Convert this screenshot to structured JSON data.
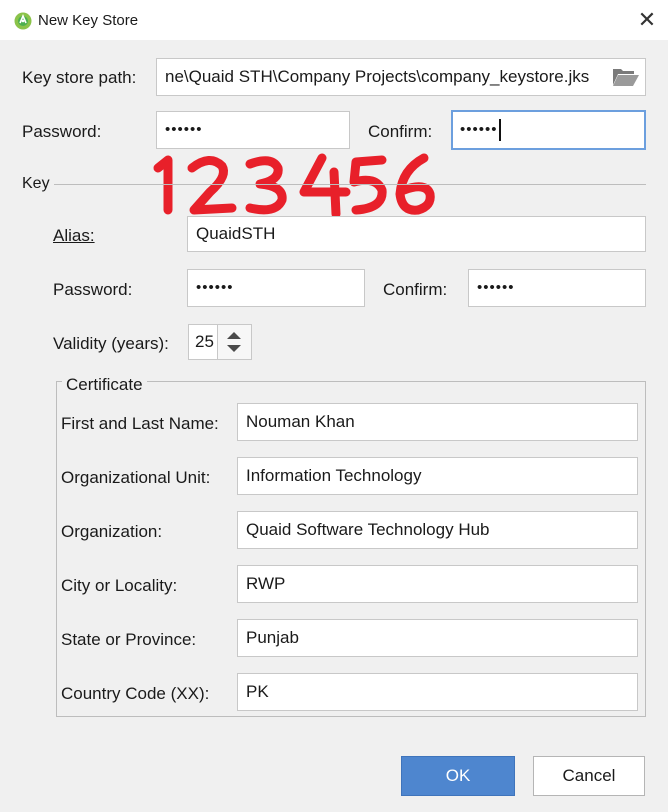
{
  "window": {
    "title": "New Key Store",
    "close_symbol": "✕"
  },
  "keystore": {
    "path_label": "Key store path:",
    "path_value": "ne\\Quaid STH\\Company Projects\\company_keystore.jks",
    "password_label": "Password:",
    "password_value": "••••••",
    "confirm_label": "Confirm:",
    "confirm_value": "••••••"
  },
  "annotation": {
    "text": "123456",
    "color": "#e8202a"
  },
  "key": {
    "section_label": "Key",
    "alias_label": "Alias:",
    "alias_value": "QuaidSTH",
    "password_label": "Password:",
    "password_value": "••••••",
    "confirm_label": "Confirm:",
    "confirm_value": "••••••",
    "validity_label": "Validity (years):",
    "validity_value": "25"
  },
  "certificate": {
    "legend": "Certificate",
    "first_last_label": "First and Last Name:",
    "first_last_value": "Nouman Khan",
    "org_unit_label": "Organizational Unit:",
    "org_unit_value": "Information Technology",
    "organization_label": "Organization:",
    "organization_value": "Quaid Software Technology Hub",
    "city_label": "City or Locality:",
    "city_value": "RWP",
    "state_label": "State or Province:",
    "state_value": "Punjab",
    "country_label": "Country Code (XX):",
    "country_value": "PK"
  },
  "buttons": {
    "ok": "OK",
    "cancel": "Cancel"
  },
  "colors": {
    "accent": "#4e86cf",
    "focus_border": "#6c9fde",
    "icon_green": "#8bc34a"
  },
  "icons": {
    "app": "android-studio-icon",
    "folder": "folder-open-icon",
    "close": "close-icon"
  }
}
